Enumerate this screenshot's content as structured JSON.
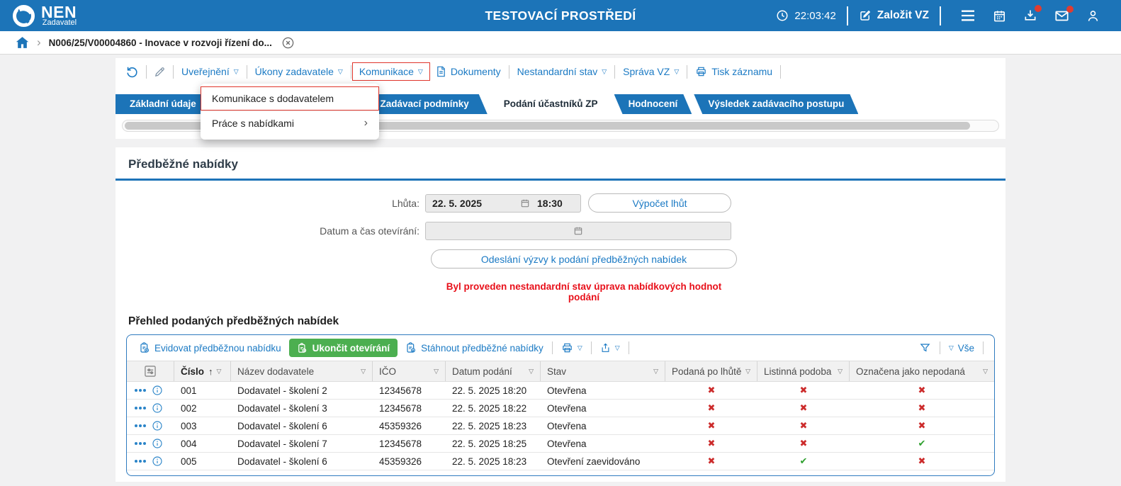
{
  "icons": {
    "filter": "▽",
    "sort_asc": "↑",
    "chevron": "›",
    "submenu": "›",
    "check": "✔",
    "cross": "✖"
  },
  "colors": {
    "brand_blue": "#1c74b8",
    "link_blue": "#1b7ac4",
    "green_button": "#4caf50",
    "red_mark": "#cc2b2b",
    "green_mark": "#2fa02f",
    "warning_red": "#e8101a",
    "annotation_red": "#e0352b"
  },
  "header": {
    "logo": "NEN",
    "role": "Zadavatel",
    "title": "TESTOVACÍ PROSTŘEDÍ",
    "time": "22:03:42",
    "create_vz": "Založit VZ"
  },
  "breadcrumb": {
    "record": "N006/25/V00004860 - Inovace v rozvoji řízení do..."
  },
  "toolbar": {
    "uverejneni": "Uveřejnění",
    "ukony_zadavatele": "Úkony zadavatele",
    "komunikace": "Komunikace",
    "dokumenty": "Dokumenty",
    "nestandardni_stav": "Nestandardní stav",
    "sprava_vz": "Správa VZ",
    "tisk_zaznamu": "Tisk záznamu"
  },
  "menu": {
    "komunikace_s_dodavatelem": "Komunikace s dodavatelem",
    "prace_s_nabidkami": "Práce s nabídkami"
  },
  "tabs": {
    "zakladni_udaje": "Základní údaje",
    "zadavaci_podminky": "Zadávací podmínky",
    "podani_ucastniku": "Podání účastníků ZP",
    "hodnoceni": "Hodnocení",
    "vysledek": "Výsledek zadávacího postupu"
  },
  "section": {
    "title": "Předběžné nabídky",
    "lhuta_label": "Lhůta:",
    "lhuta_date": "22. 5. 2025",
    "lhuta_time": "18:30",
    "vypocet_lhut": "Výpočet lhůt",
    "oteviranie_label": "Datum a čas otevírání:",
    "odeslani_vyzvy": "Odeslání výzvy k podání předběžných nabídek",
    "warning": "Byl proveden nestandardní stav úprava nabídkových hodnot podání"
  },
  "table": {
    "title": "Přehled podaných předběžných nabídek",
    "actions": {
      "evidovat": "Evidovat předběžnou nabídku",
      "ukoncit": "Ukončit otevírání",
      "stahnout": "Stáhnout předběžné nabídky",
      "vse": "Vše"
    },
    "columns": [
      {
        "label": "Číslo"
      },
      {
        "label": "Název dodavatele"
      },
      {
        "label": "IČO"
      },
      {
        "label": "Datum podání"
      },
      {
        "label": "Stav"
      },
      {
        "label": "Podaná po lhůtě"
      },
      {
        "label": "Listinná podoba"
      },
      {
        "label": "Označena jako nepodaná"
      }
    ],
    "rows": [
      {
        "cislo": "001",
        "dodavatel": "Dodavatel - školení 2",
        "ico": "12345678",
        "datum": "22. 5. 2025 18:20",
        "stav": "Otevřena",
        "po_lhute": "cross",
        "listinna": "cross",
        "nepodana": "cross"
      },
      {
        "cislo": "002",
        "dodavatel": "Dodavatel - školení 3",
        "ico": "12345678",
        "datum": "22. 5. 2025 18:22",
        "stav": "Otevřena",
        "po_lhute": "cross",
        "listinna": "cross",
        "nepodana": "cross"
      },
      {
        "cislo": "003",
        "dodavatel": "Dodavatel - školení 6",
        "ico": "45359326",
        "datum": "22. 5. 2025 18:23",
        "stav": "Otevřena",
        "po_lhute": "cross",
        "listinna": "cross",
        "nepodana": "cross"
      },
      {
        "cislo": "004",
        "dodavatel": "Dodavatel - školení 7",
        "ico": "12345678",
        "datum": "22. 5. 2025 18:25",
        "stav": "Otevřena",
        "po_lhute": "cross",
        "listinna": "cross",
        "nepodana": "check"
      },
      {
        "cislo": "005",
        "dodavatel": "Dodavatel - školení 6",
        "ico": "45359326",
        "datum": "22. 5. 2025 18:23",
        "stav": "Otevření zaevidováno",
        "po_lhute": "cross",
        "listinna": "check",
        "nepodana": "cross"
      }
    ]
  }
}
